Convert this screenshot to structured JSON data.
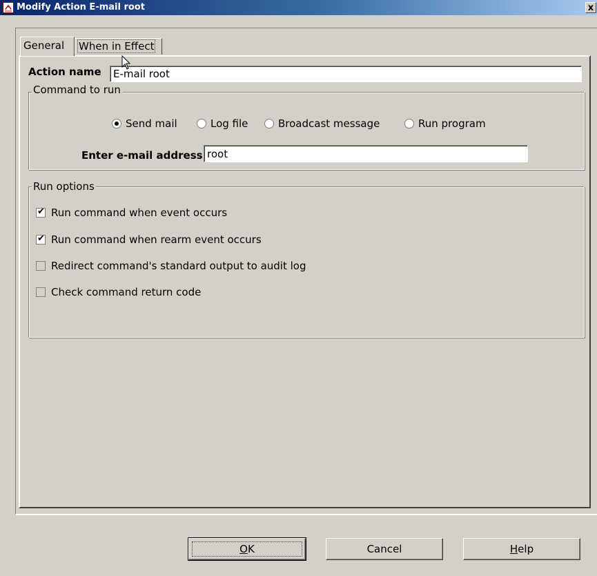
{
  "window": {
    "title": "Modify Action E-mail root",
    "close_glyph": "x"
  },
  "tabs": [
    {
      "label": "General",
      "active": true
    },
    {
      "label": "When in Effect",
      "active": false
    }
  ],
  "general": {
    "action_name_label": "Action name",
    "action_name_value": "E-mail root",
    "command_group_title": "Command to run",
    "command_options": [
      {
        "label": "Send mail",
        "selected": true
      },
      {
        "label": "Log file",
        "selected": false
      },
      {
        "label": "Broadcast message",
        "selected": false
      },
      {
        "label": "Run program",
        "selected": false
      }
    ],
    "email_label": "Enter e-mail address",
    "email_value": "root",
    "run_options_title": "Run options",
    "run_options": [
      {
        "label": "Run command when event occurs",
        "checked": true
      },
      {
        "label": "Run command when rearm event occurs",
        "checked": true
      },
      {
        "label": "Redirect command's standard output to audit log",
        "checked": false
      },
      {
        "label": "Check command return code",
        "checked": false
      }
    ]
  },
  "buttons": {
    "ok": {
      "label": "OK",
      "mnemonic": "O",
      "rest": "K"
    },
    "cancel": {
      "label": "Cancel"
    },
    "help": {
      "label": "Help",
      "mnemonic": "H",
      "rest": "elp"
    }
  },
  "colors": {
    "face": "#d4d0c8",
    "titlebar_start": "#0a246a",
    "titlebar_end": "#a6caf0"
  }
}
